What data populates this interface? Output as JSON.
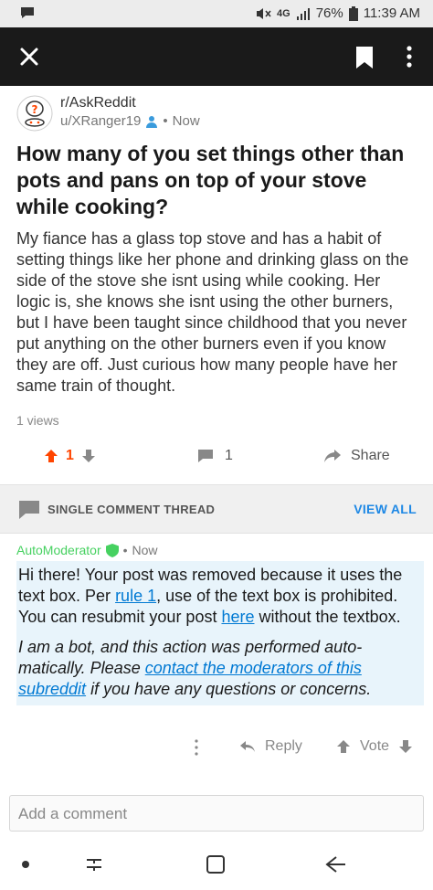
{
  "statusbar": {
    "network": "4G",
    "battery": "76%",
    "time": "11:39 AM"
  },
  "topbar": {
    "icons": [
      "close-icon",
      "bookmark-icon",
      "more-vertical-icon"
    ]
  },
  "post": {
    "subreddit": "r/AskReddit",
    "author": "u/XRanger19",
    "separator": "•",
    "time": "Now",
    "title": "How many of you set things other than pots and pans on top of your stove while cooking?",
    "body": "My fiance has a glass top stove and has a habit of setting things like her phone and drinking glass on the side of the stove she isnt using while cooking. Her logic is, she knows she isnt using the other burners, but I have been taught since childhood that you never put anything on the other burners even if you know they are off. Just curious how many people have her same train of thought.",
    "views": "1 views",
    "score": "1",
    "comment_count": "1",
    "share_label": "Share"
  },
  "thread": {
    "label": "SINGLE COMMENT THREAD",
    "view_all": "VIEW ALL"
  },
  "comment": {
    "author": "AutoModerator",
    "separator": "•",
    "time": "Now",
    "p1_a": "Hi there! Your post was removed because it uses the text box. Per ",
    "p1_link1": "rule 1",
    "p1_b": ", use of the text box is prohibited. You can resubmit your post ",
    "p1_link2": "here",
    "p1_c": " without the textbox.",
    "p2_a": "I am a bot, and this action was performed auto-matically. Please ",
    "p2_link": "contact the moderators of this subreddit",
    "p2_b": " if you have any questions or concerns.",
    "reply_label": "Reply",
    "vote_label": "Vote"
  },
  "composer": {
    "placeholder": "Add a comment"
  },
  "colors": {
    "upvote": "#ff4500",
    "mod_green": "#46d160",
    "link_blue": "#0079d3",
    "topbar": "#1a1a1a"
  }
}
